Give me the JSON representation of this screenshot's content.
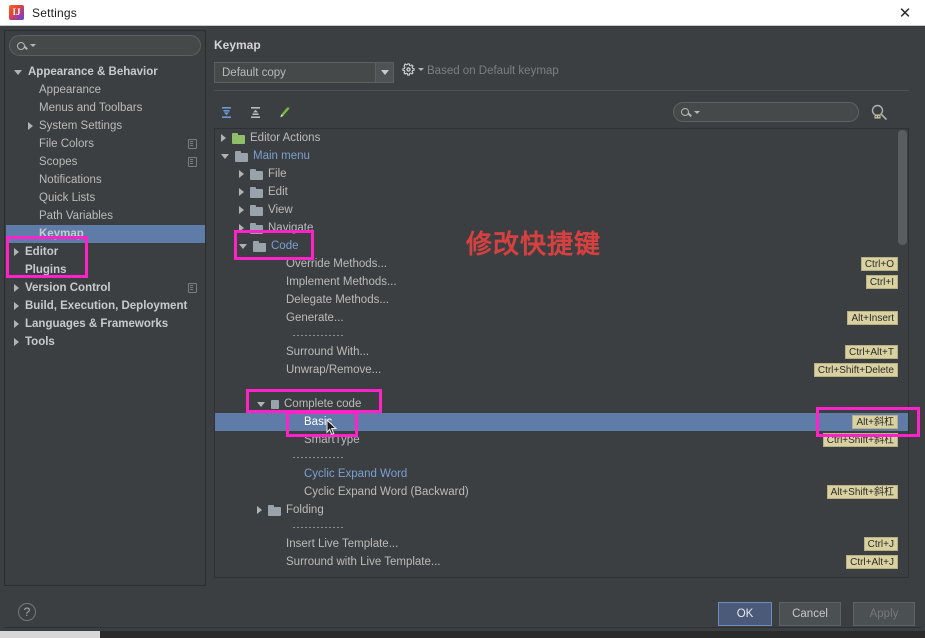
{
  "window": {
    "title": "Settings",
    "app_icon": "intellij-idea-icon",
    "close_icon": "close-icon"
  },
  "sidebar": {
    "search": {
      "placeholder": "",
      "value": "",
      "icon": "search-icon"
    },
    "items": [
      {
        "label": "Appearance & Behavior",
        "arrow": "down",
        "indent": 0,
        "bold": true,
        "selected": false,
        "badge": false
      },
      {
        "label": "Appearance",
        "arrow": "none",
        "indent": 1,
        "bold": false,
        "selected": false,
        "badge": false
      },
      {
        "label": "Menus and Toolbars",
        "arrow": "none",
        "indent": 1,
        "bold": false,
        "selected": false,
        "badge": false
      },
      {
        "label": "System Settings",
        "arrow": "right",
        "indent": 1,
        "bold": false,
        "selected": false,
        "badge": false
      },
      {
        "label": "File Colors",
        "arrow": "none",
        "indent": 1,
        "bold": false,
        "selected": false,
        "badge": true
      },
      {
        "label": "Scopes",
        "arrow": "none",
        "indent": 1,
        "bold": false,
        "selected": false,
        "badge": true
      },
      {
        "label": "Notifications",
        "arrow": "none",
        "indent": 1,
        "bold": false,
        "selected": false,
        "badge": false
      },
      {
        "label": "Quick Lists",
        "arrow": "none",
        "indent": 1,
        "bold": false,
        "selected": false,
        "badge": false
      },
      {
        "label": "Path Variables",
        "arrow": "none",
        "indent": 1,
        "bold": false,
        "selected": false,
        "badge": false
      },
      {
        "label": "Keymap",
        "arrow": "none",
        "indent": 1,
        "bold": true,
        "selected": true,
        "badge": false
      },
      {
        "label": "Editor",
        "arrow": "right",
        "indent": 0,
        "bold": true,
        "selected": false,
        "badge": false
      },
      {
        "label": "Plugins",
        "arrow": "none",
        "indent": 0,
        "bold": true,
        "selected": false,
        "badge": false
      },
      {
        "label": "Version Control",
        "arrow": "right",
        "indent": 0,
        "bold": true,
        "selected": false,
        "badge": true
      },
      {
        "label": "Build, Execution, Deployment",
        "arrow": "right",
        "indent": 0,
        "bold": true,
        "selected": false,
        "badge": false
      },
      {
        "label": "Languages & Frameworks",
        "arrow": "right",
        "indent": 0,
        "bold": true,
        "selected": false,
        "badge": false
      },
      {
        "label": "Tools",
        "arrow": "right",
        "indent": 0,
        "bold": true,
        "selected": false,
        "badge": false
      }
    ]
  },
  "panel": {
    "title": "Keymap",
    "keymap_select": {
      "value": "Default copy",
      "chevron": "chevron-down-icon"
    },
    "gear": {
      "icon": "gear-icon",
      "caret": "chevron-down-icon"
    },
    "based_on": "Based on Default keymap",
    "toolbar": [
      {
        "name": "expand-all-icon"
      },
      {
        "name": "collapse-all-icon"
      },
      {
        "name": "edit-shortcut-icon"
      }
    ],
    "search": {
      "placeholder": "",
      "value": "",
      "icon": "search-icon"
    },
    "find_by_shortcut": {
      "icon": "find-by-shortcut-icon"
    }
  },
  "tree": [
    {
      "label": "Editor Actions",
      "arrow": "right",
      "icon": "folder-green",
      "indent": 0,
      "link": false,
      "shortcut": "",
      "selected": false
    },
    {
      "label": "Main menu",
      "arrow": "down",
      "icon": "folder-menu",
      "indent": 0,
      "link": true,
      "shortcut": "",
      "selected": false
    },
    {
      "label": "File",
      "arrow": "right",
      "icon": "folder",
      "indent": 1,
      "link": false,
      "shortcut": "",
      "selected": false
    },
    {
      "label": "Edit",
      "arrow": "right",
      "icon": "folder",
      "indent": 1,
      "link": false,
      "shortcut": "",
      "selected": false
    },
    {
      "label": "View",
      "arrow": "right",
      "icon": "folder",
      "indent": 1,
      "link": false,
      "shortcut": "",
      "selected": false
    },
    {
      "label": "Navigate",
      "arrow": "right",
      "icon": "folder",
      "indent": 1,
      "link": false,
      "shortcut": "",
      "selected": false
    },
    {
      "label": "Code",
      "arrow": "down",
      "icon": "folder",
      "indent": 1,
      "link": true,
      "shortcut": "",
      "selected": false
    },
    {
      "label": "Override Methods...",
      "arrow": "none",
      "icon": "none",
      "indent": 3,
      "link": false,
      "shortcut": "Ctrl+O",
      "selected": false
    },
    {
      "label": "Implement Methods...",
      "arrow": "none",
      "icon": "none",
      "indent": 3,
      "link": false,
      "shortcut": "Ctrl+I",
      "selected": false
    },
    {
      "label": "Delegate Methods...",
      "arrow": "none",
      "icon": "none",
      "indent": 3,
      "link": false,
      "shortcut": "",
      "selected": false
    },
    {
      "label": "Generate...",
      "arrow": "none",
      "icon": "none",
      "indent": 3,
      "link": false,
      "shortcut": "Alt+Insert",
      "selected": false
    },
    {
      "label": "",
      "arrow": "none",
      "icon": "separator",
      "indent": 3,
      "link": false,
      "shortcut": "",
      "selected": false
    },
    {
      "label": "Surround With...",
      "arrow": "none",
      "icon": "none",
      "indent": 3,
      "link": false,
      "shortcut": "Ctrl+Alt+T",
      "selected": false
    },
    {
      "label": "Unwrap/Remove...",
      "arrow": "none",
      "icon": "none",
      "indent": 3,
      "link": false,
      "shortcut": "Ctrl+Shift+Delete",
      "selected": false
    },
    {
      "label": "",
      "arrow": "none",
      "icon": "spacer",
      "indent": 3,
      "link": false,
      "shortcut": "",
      "selected": false
    },
    {
      "label": "Complete code",
      "arrow": "down",
      "icon": "chip",
      "indent": 2,
      "link": false,
      "shortcut": "",
      "selected": false
    },
    {
      "label": "Basic",
      "arrow": "none",
      "icon": "none",
      "indent": 4,
      "link": false,
      "shortcut": "Alt+斜杠",
      "selected": true
    },
    {
      "label": "SmartType",
      "arrow": "none",
      "icon": "none",
      "indent": 4,
      "link": false,
      "shortcut": "Ctrl+Shift+斜杠",
      "selected": false
    },
    {
      "label": "",
      "arrow": "none",
      "icon": "separator",
      "indent": 4,
      "link": false,
      "shortcut": "",
      "selected": false
    },
    {
      "label": "Cyclic Expand Word",
      "arrow": "none",
      "icon": "none",
      "indent": 4,
      "link": true,
      "shortcut": "",
      "selected": false
    },
    {
      "label": "Cyclic Expand Word (Backward)",
      "arrow": "none",
      "icon": "none",
      "indent": 4,
      "link": false,
      "shortcut": "Alt+Shift+斜杠",
      "selected": false
    },
    {
      "label": "Folding",
      "arrow": "right",
      "icon": "folder",
      "indent": 2,
      "link": false,
      "shortcut": "",
      "selected": false
    },
    {
      "label": "",
      "arrow": "none",
      "icon": "separator",
      "indent": 3,
      "link": false,
      "shortcut": "",
      "selected": false
    },
    {
      "label": "Insert Live Template...",
      "arrow": "none",
      "icon": "none",
      "indent": 3,
      "link": false,
      "shortcut": "Ctrl+J",
      "selected": false
    },
    {
      "label": "Surround with Live Template...",
      "arrow": "none",
      "icon": "none",
      "indent": 3,
      "link": false,
      "shortcut": "Ctrl+Alt+J",
      "selected": false
    }
  ],
  "annotation": {
    "note_text": "修改快捷键",
    "note_color": "#d64040",
    "highlight_color": "#ff22c8"
  },
  "footer": {
    "help_label": "?",
    "ok_label": "OK",
    "cancel_label": "Cancel",
    "apply_label": "Apply"
  }
}
